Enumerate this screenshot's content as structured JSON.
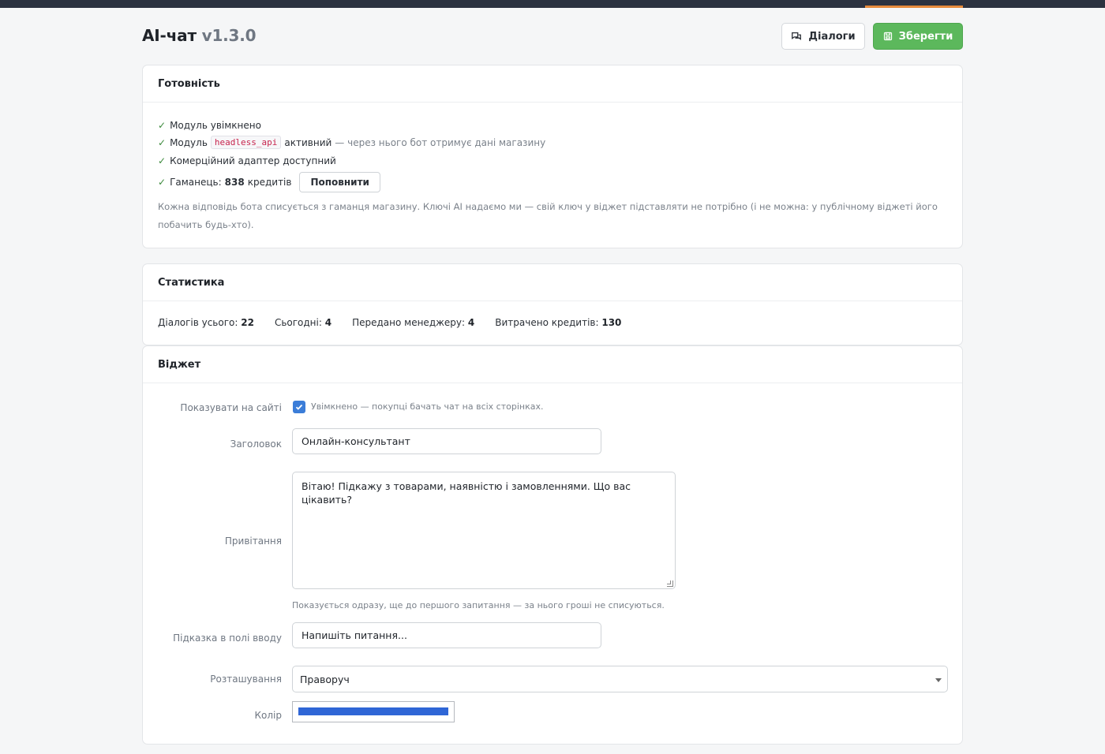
{
  "header": {
    "title": "AI-чат",
    "version": "v1.3.0",
    "dialogs_label": "Діалоги",
    "save_label": "Зберегти"
  },
  "readiness": {
    "title": "Готовність",
    "item1": "Модуль увімкнено",
    "item2_prefix": "Модуль",
    "item2_code": "headless_api",
    "item2_active": "активний",
    "item2_note": "— через нього бот отримує дані магазину",
    "item3": "Комерційний адаптер доступний",
    "item4_prefix": "Гаманець:",
    "item4_credits": "838",
    "item4_suffix": "кредитів",
    "topup_label": "Поповнити",
    "note": "Кожна відповідь бота списується з гаманця магазину. Ключі AI надаємо ми — свій ключ у віджет підставляти не потрібно (і не можна: у публічному віджеті його побачить будь-хто)."
  },
  "stats": {
    "title": "Статистика",
    "total_label": "Діалогів усього:",
    "total": "22",
    "today_label": "Сьогодні:",
    "today": "4",
    "handed_label": "Передано менеджеру:",
    "handed": "4",
    "spent_label": "Витрачено кредитів:",
    "spent": "130"
  },
  "widget": {
    "title": "Віджет",
    "show_label": "Показувати на сайті",
    "show_checked": true,
    "show_text": "Увімкнено — покупці бачать чат на всіх сторінках.",
    "heading_label": "Заголовок",
    "heading_value": "Онлайн-консультант",
    "greeting_label": "Привітання",
    "greeting_value": "Вітаю! Підкажу з товарами, наявністю і замовленнями. Що вас цікавить?",
    "greeting_help": "Показується одразу, ще до першого запитання — за нього гроші не списуються.",
    "placeholder_label": "Підказка в полі вводу",
    "placeholder_value": "Напишіть питання...",
    "position_label": "Розташування",
    "position_value": "Праворуч",
    "color_label": "Колір",
    "color_value": "#2f66d6"
  },
  "colors": {
    "topbar": "#2b3240",
    "accent": "#e58a3c",
    "save": "#5cb85c",
    "checkbox": "#3b7dd8"
  }
}
